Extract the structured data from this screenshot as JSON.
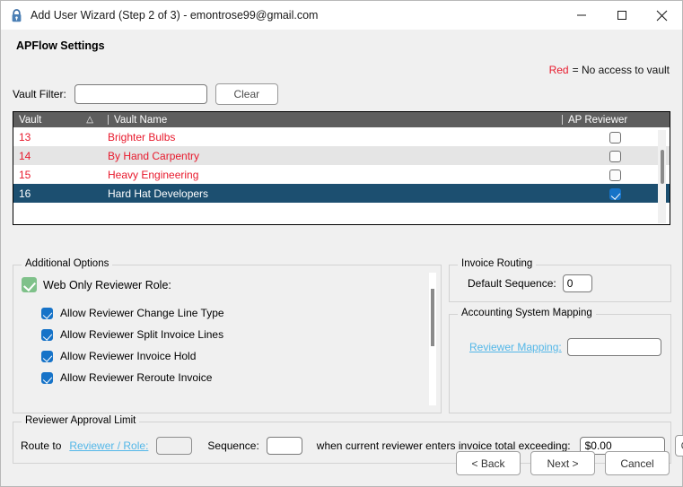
{
  "window": {
    "title": "Add User Wizard (Step 2 of 3) - emontrose99@gmail.com",
    "lock_icon": "lock-icon",
    "minimize_label": "–",
    "maximize_label": "□",
    "close_label": "✕"
  },
  "page": {
    "heading": "APFlow Settings"
  },
  "legend": {
    "red_word": "Red",
    "description": "= No access to vault",
    "red_color": "#e8192c"
  },
  "filter": {
    "label": "Vault Filter:",
    "value": "",
    "placeholder": "",
    "clear_label": "Clear"
  },
  "vault_table": {
    "columns": [
      "Vault",
      "Vault Name",
      "AP Reviewer"
    ],
    "sort_indicator": "△",
    "rows": [
      {
        "id": "13",
        "name": "Brighter Bulbs",
        "ap_reviewer": false,
        "no_access": true,
        "selected": false
      },
      {
        "id": "14",
        "name": "By Hand Carpentry",
        "ap_reviewer": false,
        "no_access": true,
        "selected": false
      },
      {
        "id": "15",
        "name": "Heavy Engineering",
        "ap_reviewer": false,
        "no_access": true,
        "selected": false
      },
      {
        "id": "16",
        "name": "Hard Hat Developers",
        "ap_reviewer": true,
        "no_access": false,
        "selected": true
      }
    ],
    "selected_row_color": "#1c4f70",
    "header_color": "#5e5e5e"
  },
  "additional_options": {
    "title": "Additional Options",
    "web_only": {
      "label": "Web Only Reviewer Role:",
      "checked": true,
      "color": "#7fc18a"
    },
    "sub_options": [
      {
        "label": "Allow Reviewer Change Line Type",
        "checked": true
      },
      {
        "label": "Allow Reviewer Split Invoice Lines",
        "checked": true
      },
      {
        "label": "Allow Reviewer Invoice Hold",
        "checked": true
      },
      {
        "label": "Allow Reviewer Reroute Invoice",
        "checked": true
      }
    ]
  },
  "invoice_routing": {
    "title": "Invoice Routing",
    "default_sequence_label": "Default Sequence:",
    "default_sequence_value": "0"
  },
  "accounting_mapping": {
    "title": "Accounting System Mapping",
    "reviewer_mapping_label": "Reviewer Mapping:",
    "reviewer_mapping_value": "",
    "link_color": "#53b7e8"
  },
  "approval_limit": {
    "title": "Reviewer Approval Limit",
    "route_to_label": "Route to",
    "reviewer_role_link": "Reviewer / Role:",
    "reviewer_role_value": "",
    "sequence_label": "Sequence:",
    "sequence_value": "",
    "exceeding_label": "when current reviewer enters invoice total exceeding:",
    "amount_value": "$0.00",
    "clear_label": "Clear"
  },
  "footer": {
    "back_label": "< Back",
    "next_label": "Next >",
    "cancel_label": "Cancel"
  }
}
